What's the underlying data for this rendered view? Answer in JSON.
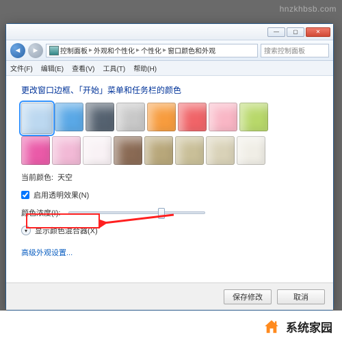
{
  "watermark": "hnzkhbsb.com",
  "window": {
    "breadcrumb": {
      "a": "控制面板",
      "b": "外观和个性化",
      "c": "个性化",
      "d": "窗口颜色和外观"
    },
    "search_placeholder": "搜索控制面板",
    "menu": {
      "file": "文件(F)",
      "edit": "编辑(E)",
      "view": "查看(V)",
      "tools": "工具(T)",
      "help": "帮助(H)"
    }
  },
  "content": {
    "heading": "更改窗口边框、「开始」菜单和任务栏的颜色",
    "current_color_label": "当前颜色:",
    "current_color_value": "天空",
    "transparency_label": "启用透明效果(N)",
    "intensity_label": "颜色浓度(I):",
    "mixer_label": "显示颜色混合器(X)",
    "advanced_link": "高级外观设置...",
    "colors": [
      "#bcd8f0",
      "#5aa8e6",
      "#556270",
      "#c8c8c8",
      "#f79c3e",
      "#f06468",
      "#f9b6c5",
      "#b8d86a",
      "#ea5aa8",
      "#f2b9d6",
      "#f9f2f5",
      "#8a6a54",
      "#b8a77a",
      "#c9bf98",
      "#d9d2b8",
      "#f0eee6"
    ]
  },
  "footer": {
    "save": "保存修改",
    "cancel": "取消"
  },
  "brand": "系统家园"
}
